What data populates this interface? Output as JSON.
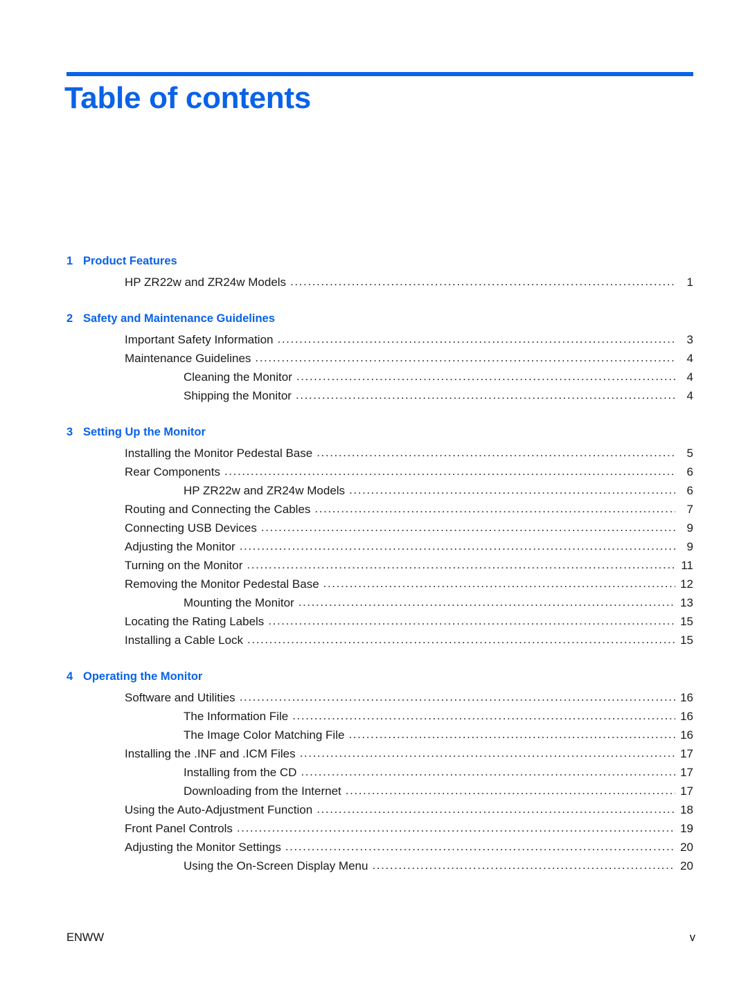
{
  "document": {
    "title": "Table of contents",
    "accent_color": "#0a62e8",
    "text_color": "#1a1a1a",
    "leader_char": "."
  },
  "footer": {
    "left": "ENWW",
    "right": "v"
  },
  "toc": {
    "chapters": [
      {
        "number": "1",
        "title": "Product Features",
        "entries": [
          {
            "level": 1,
            "label": "HP ZR22w and ZR24w Models",
            "page": "1"
          }
        ]
      },
      {
        "number": "2",
        "title": "Safety and Maintenance Guidelines",
        "entries": [
          {
            "level": 1,
            "label": "Important Safety Information",
            "page": "3"
          },
          {
            "level": 1,
            "label": "Maintenance Guidelines",
            "page": "4"
          },
          {
            "level": 2,
            "label": "Cleaning the Monitor",
            "page": "4"
          },
          {
            "level": 2,
            "label": "Shipping the Monitor",
            "page": "4"
          }
        ]
      },
      {
        "number": "3",
        "title": "Setting Up the Monitor",
        "entries": [
          {
            "level": 1,
            "label": "Installing the Monitor Pedestal Base",
            "page": "5"
          },
          {
            "level": 1,
            "label": "Rear Components",
            "page": "6"
          },
          {
            "level": 2,
            "label": "HP ZR22w and ZR24w Models",
            "page": "6"
          },
          {
            "level": 1,
            "label": "Routing and Connecting the Cables",
            "page": "7"
          },
          {
            "level": 1,
            "label": "Connecting USB Devices",
            "page": "9"
          },
          {
            "level": 1,
            "label": "Adjusting the Monitor",
            "page": "9"
          },
          {
            "level": 1,
            "label": "Turning on the Monitor",
            "page": "11"
          },
          {
            "level": 1,
            "label": "Removing the Monitor Pedestal Base",
            "page": "12"
          },
          {
            "level": 2,
            "label": "Mounting the Monitor",
            "page": "13"
          },
          {
            "level": 1,
            "label": "Locating the Rating Labels",
            "page": "15"
          },
          {
            "level": 1,
            "label": "Installing a Cable Lock",
            "page": "15"
          }
        ]
      },
      {
        "number": "4",
        "title": "Operating the Monitor",
        "entries": [
          {
            "level": 1,
            "label": "Software and Utilities",
            "page": "16"
          },
          {
            "level": 2,
            "label": "The Information File",
            "page": "16"
          },
          {
            "level": 2,
            "label": "The Image Color Matching File",
            "page": "16"
          },
          {
            "level": 1,
            "label": "Installing the .INF and .ICM Files",
            "page": "17"
          },
          {
            "level": 2,
            "label": "Installing from the CD",
            "page": "17"
          },
          {
            "level": 2,
            "label": "Downloading from the Internet",
            "page": "17"
          },
          {
            "level": 1,
            "label": "Using the Auto-Adjustment Function",
            "page": "18"
          },
          {
            "level": 1,
            "label": "Front Panel Controls",
            "page": "19"
          },
          {
            "level": 1,
            "label": "Adjusting the Monitor Settings",
            "page": "20"
          },
          {
            "level": 2,
            "label": "Using the On-Screen Display Menu",
            "page": "20"
          }
        ]
      }
    ]
  }
}
